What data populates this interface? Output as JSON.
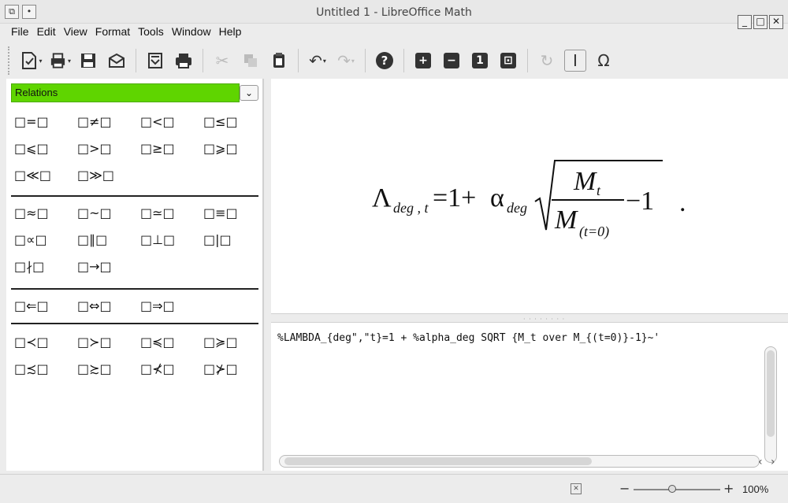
{
  "window": {
    "title": "Untitled 1 - LibreOffice Math",
    "minimize": "_",
    "maximize": "□",
    "close": "✕"
  },
  "menu": [
    "File",
    "Edit",
    "View",
    "Format",
    "Tools",
    "Window",
    "Help"
  ],
  "toolbar": {
    "tools": [
      "new-document",
      "print-preview",
      "save",
      "email",
      "export-pdf",
      "print",
      "cut",
      "copy",
      "paste",
      "undo",
      "redo",
      "help",
      "zoom-in",
      "zoom-out",
      "zoom-100",
      "show-all",
      "update",
      "formula-cursor",
      "symbols"
    ],
    "zoom_in_label": "+",
    "zoom_out_label": "−",
    "zoom_100_label": "1",
    "symbols_label": "Ω"
  },
  "elements": {
    "category": "Relations",
    "groups": [
      [
        "□=□",
        "□≠□",
        "□<□",
        "□≤□",
        "□⩽□",
        "□>□",
        "□≥□",
        "□⩾□",
        "□≪□",
        "□≫□"
      ],
      [
        "□≈□",
        "□~□",
        "□≃□",
        "□≡□",
        "□∝□",
        "□∥□",
        "□⊥□",
        "□|□",
        "□∤□",
        "□→□"
      ],
      [
        "□⇐□",
        "□⇔□",
        "□⇒□"
      ],
      [
        "□≺□",
        "□≻□",
        "□≼□",
        "□≽□",
        "□≾□",
        "□≿□",
        "□⊀□",
        "□⊁□"
      ]
    ]
  },
  "formula": {
    "lambda": "Λ",
    "lambda_sub": "deg , t",
    "equals_one_plus": "=1+",
    "alpha": "α",
    "alpha_sub": "deg",
    "numerator": "M",
    "numerator_sub": "t",
    "denominator": "M",
    "denominator_sub": "(t=0)",
    "minus_one": "−1",
    "trailing_dot": "."
  },
  "command": {
    "text": "%LAMBDA_{deg\",\"t}=1 + %alpha_deg SQRT {M_t over M_{(t=0)}-1}~'"
  },
  "status": {
    "zoom": "100%",
    "zoom_minus": "−",
    "zoom_plus": "+"
  }
}
